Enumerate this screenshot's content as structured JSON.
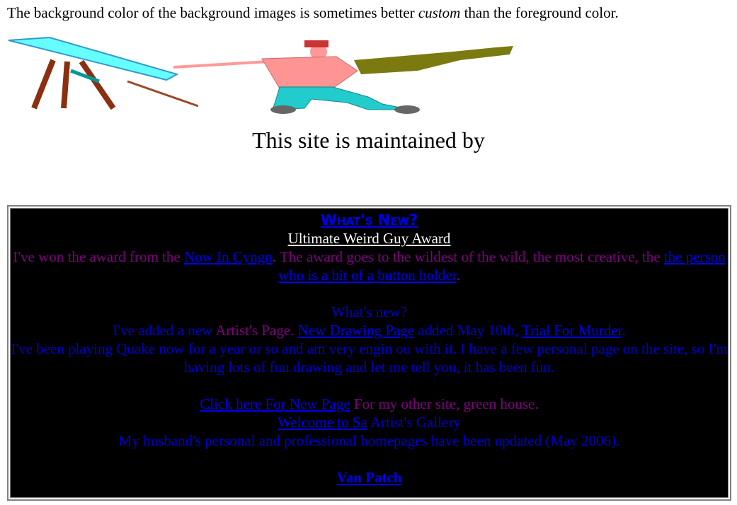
{
  "intro": {
    "before": "The background color of the background images is sometimes better ",
    "emph": "custom",
    "after": " than the foreground color."
  },
  "maintained_text": "This site is maintained by",
  "news": {
    "heading": "What's New?",
    "award_link": "Ultimate Weird Guy Award",
    "award_p1": "I've won the award from the ",
    "award_link2": "Now In Cyngn",
    "award_p2": ". The award goes to the wildest of the wild, the most creative, the ",
    "award_link3": "the person who is a bit of a button holder",
    "award_p3": ".",
    "whats_new": "What's new?",
    "added_p1": "I've added a new ",
    "added_artist": "Artist's Page. ",
    "added_link1": "New Drawing Page",
    "added_p2": " added May 10th, ",
    "added_link2": "Trial For Murder",
    "added_p3": ".",
    "quake": "I've been playing Quake now for a year or so and am very engin ou with it. I have a few personal page on the site, so I'm having lots of fun drawing and let me tell you, it has been fun.",
    "click_link": "Click here For New Page",
    "click_after": " For my other site, green house.",
    "welcome_link": "Welcome to Sa",
    "welcome_after": " Artist's Gallery",
    "husband": "My husband's personal and professional homepages have been updated (May 2006).",
    "vanpatch": "Van Patch"
  },
  "colors": {
    "link": "#0000ee",
    "purple_text": "#800080",
    "cell_bg": "#000000"
  }
}
